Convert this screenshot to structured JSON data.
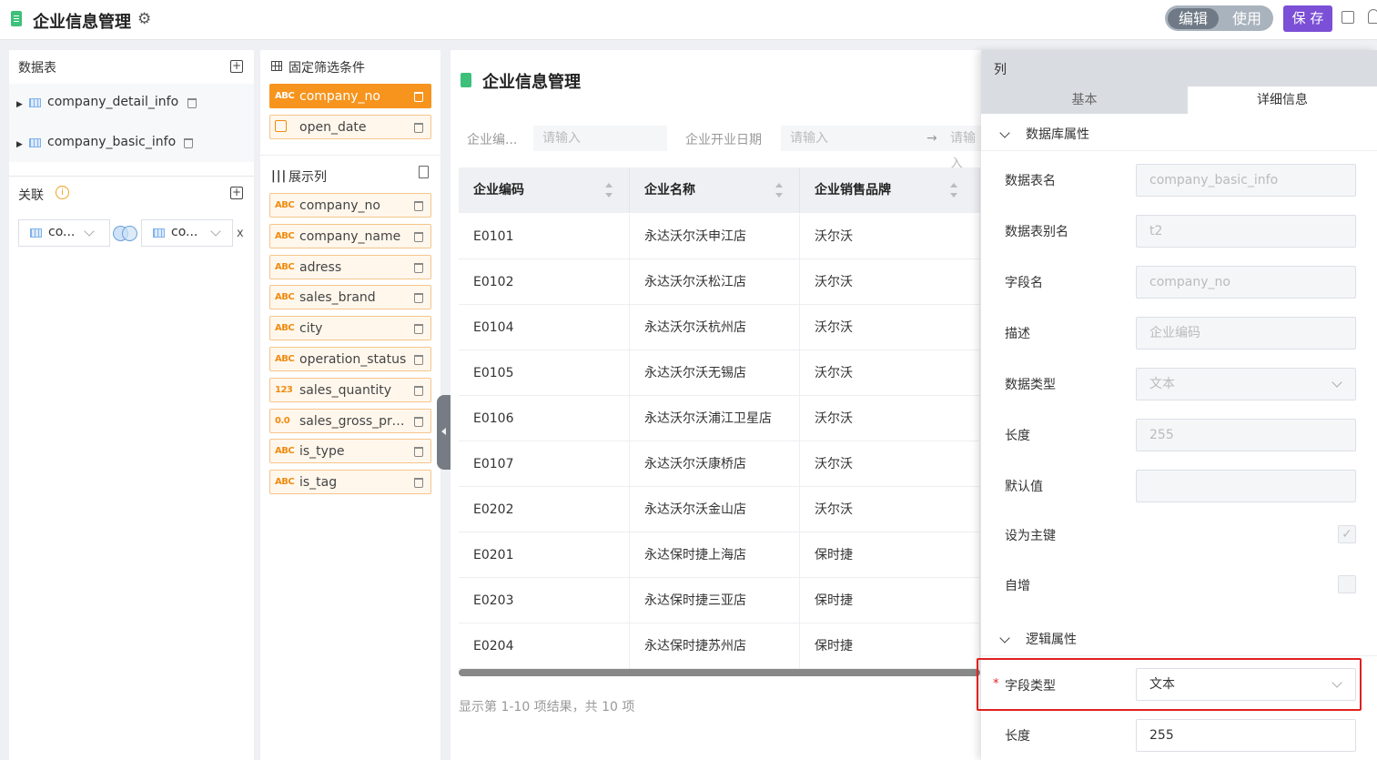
{
  "header": {
    "title": "企业信息管理",
    "mode_edit": "编辑",
    "mode_use": "使用",
    "save_label": "保 存"
  },
  "datasets": {
    "title": "数据表",
    "tables": [
      "company_detail_info",
      "company_basic_info"
    ]
  },
  "relation": {
    "title": "关联",
    "left_table": "co...",
    "right_table": "co...",
    "remove": "x"
  },
  "filters_panel": {
    "title": "固定筛选条件",
    "fields": [
      {
        "type": "ABC",
        "name": "company_no",
        "selected": true
      },
      {
        "type": "date",
        "name": "open_date",
        "selected": false
      }
    ]
  },
  "columns_panel": {
    "title": "展示列",
    "fields": [
      {
        "type": "ABC",
        "name": "company_no"
      },
      {
        "type": "ABC",
        "name": "company_name"
      },
      {
        "type": "ABC",
        "name": "adress"
      },
      {
        "type": "ABC",
        "name": "sales_brand"
      },
      {
        "type": "ABC",
        "name": "city"
      },
      {
        "type": "ABC",
        "name": "operation_status"
      },
      {
        "type": "123",
        "name": "sales_quantity"
      },
      {
        "type": "0.0",
        "name": "sales_gross_pro..."
      },
      {
        "type": "ABC",
        "name": "is_type"
      },
      {
        "type": "ABC",
        "name": "is_tag"
      }
    ]
  },
  "preview": {
    "title": "企业信息管理",
    "filter1_label": "企业编...",
    "filter1_placeholder": "请输入",
    "filter2_label": "企业开业日期",
    "filter2_placeholder": "请输入",
    "filter2_end_placeholder": "请输入",
    "headers": [
      "企业编码",
      "企业名称",
      "企业销售品牌"
    ],
    "rows": [
      [
        "E0101",
        "永达沃尔沃申江店",
        "沃尔沃"
      ],
      [
        "E0102",
        "永达沃尔沃松江店",
        "沃尔沃"
      ],
      [
        "E0104",
        "永达沃尔沃杭州店",
        "沃尔沃"
      ],
      [
        "E0105",
        "永达沃尔沃无锡店",
        "沃尔沃"
      ],
      [
        "E0106",
        "永达沃尔沃浦江卫星店",
        "沃尔沃"
      ],
      [
        "E0107",
        "永达沃尔沃康桥店",
        "沃尔沃"
      ],
      [
        "E0202",
        "永达沃尔沃金山店",
        "沃尔沃"
      ],
      [
        "E0201",
        "永达保时捷上海店",
        "保时捷"
      ],
      [
        "E0203",
        "永达保时捷三亚店",
        "保时捷"
      ],
      [
        "E0204",
        "永达保时捷苏州店",
        "保时捷"
      ]
    ],
    "footer": "显示第 1-10 项结果，共 10 项"
  },
  "props": {
    "title": "列",
    "tab_basic": "基本",
    "tab_detail": "详细信息",
    "db_section": "数据库属性",
    "db_fields": [
      {
        "label": "数据表名",
        "value": "company_basic_info"
      },
      {
        "label": "数据表别名",
        "value": "t2"
      },
      {
        "label": "字段名",
        "value": "company_no"
      },
      {
        "label": "描述",
        "value": "企业编码"
      },
      {
        "label": "数据类型",
        "value": "文本"
      },
      {
        "label": "长度",
        "value": "255"
      },
      {
        "label": "默认值",
        "value": ""
      }
    ],
    "pk_label": "设为主键",
    "auto_label": "自增",
    "logic_section": "逻辑属性",
    "logic_fields": [
      {
        "label": "字段类型",
        "value": "文本",
        "required": "*"
      },
      {
        "label": "长度",
        "value": "255"
      }
    ]
  }
}
